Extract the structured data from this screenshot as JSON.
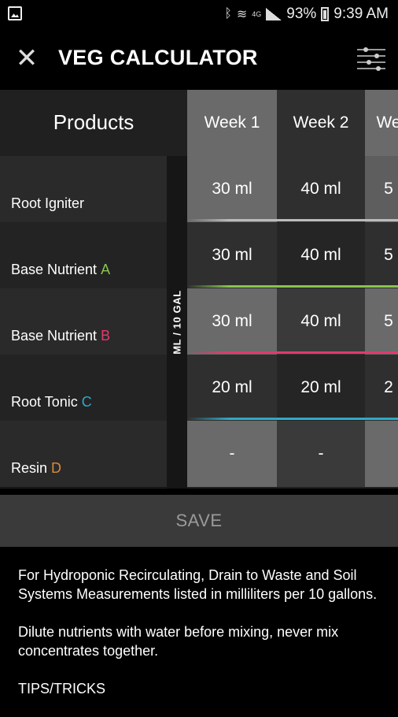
{
  "status_bar": {
    "battery": "93%",
    "time": "9:39 AM",
    "network": "4G",
    "icons": [
      "image-icon",
      "bluetooth-icon",
      "wifi-icon",
      "signal-icon",
      "battery-icon"
    ]
  },
  "app_bar": {
    "title": "VEG CALCULATOR",
    "close_icon": "close-icon",
    "filter_icon": "filter-icon"
  },
  "table": {
    "products_header": "Products",
    "unit_label": "ML / 10 GAL",
    "weeks": [
      "Week 1",
      "Week 2",
      "We"
    ],
    "products": [
      {
        "name": "Root Igniter",
        "letter": "",
        "accent": "#bbbbbb"
      },
      {
        "name": "Base Nutrient",
        "letter": "A",
        "accent": "#8ac44c"
      },
      {
        "name": "Base Nutrient",
        "letter": "B",
        "accent": "#e23a6e"
      },
      {
        "name": "Root Tonic",
        "letter": "C",
        "accent": "#2fa9c9"
      },
      {
        "name": "Resin",
        "letter": "D",
        "accent": "#d88a3c"
      }
    ],
    "values": [
      [
        "30 ml",
        "40 ml",
        "5"
      ],
      [
        "30 ml",
        "40 ml",
        "5"
      ],
      [
        "30 ml",
        "40 ml",
        "5"
      ],
      [
        "20 ml",
        "20 ml",
        "2"
      ],
      [
        "-",
        "-",
        ""
      ]
    ]
  },
  "save_label": "SAVE",
  "info": {
    "p1": "For Hydroponic Recirculating, Drain to Waste and Soil Systems Measurements listed in milliliters per 10 gallons.",
    "p2": "Dilute nutrients with water before mixing, never mix concentrates together.",
    "p3": "TIPS/TRICKS"
  }
}
